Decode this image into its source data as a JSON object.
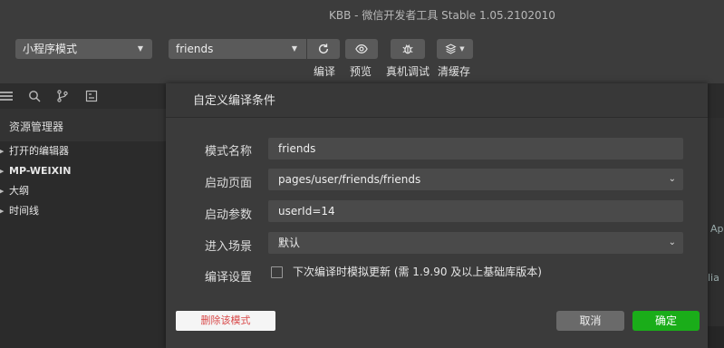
{
  "window": {
    "title": "KBB - 微信开发者工具 Stable 1.05.2102010"
  },
  "toolbar": {
    "mode_select": "小程序模式",
    "compile_select": "friends",
    "compile_label": "编译",
    "preview_label": "预览",
    "remote_debug_label": "真机调试",
    "clear_cache_label": "清缓存"
  },
  "sidebar": {
    "header": "资源管理器",
    "items": [
      {
        "label": "打开的编辑器"
      },
      {
        "label": "MP-WEIXIN"
      },
      {
        "label": "大纲"
      },
      {
        "label": "时间线"
      }
    ]
  },
  "edge_fragments": {
    "top": "Ap",
    "bottom": "lia"
  },
  "dialog": {
    "title": "自定义编译条件",
    "mode_name_label": "模式名称",
    "mode_name_value": "friends",
    "start_page_label": "启动页面",
    "start_page_value": "pages/user/friends/friends",
    "start_params_label": "启动参数",
    "start_params_value": "userId=14",
    "scene_label": "进入场景",
    "scene_value": "默认",
    "compile_settings_label": "编译设置",
    "checkbox_label": "下次编译时模拟更新 (需 1.9.90 及以上基础库版本)",
    "checkbox_checked": false,
    "delete_button": "删除该模式",
    "cancel_button": "取消",
    "ok_button": "确定"
  },
  "colors": {
    "accent_green": "#1aad19",
    "delete_red": "#d94a4a"
  }
}
